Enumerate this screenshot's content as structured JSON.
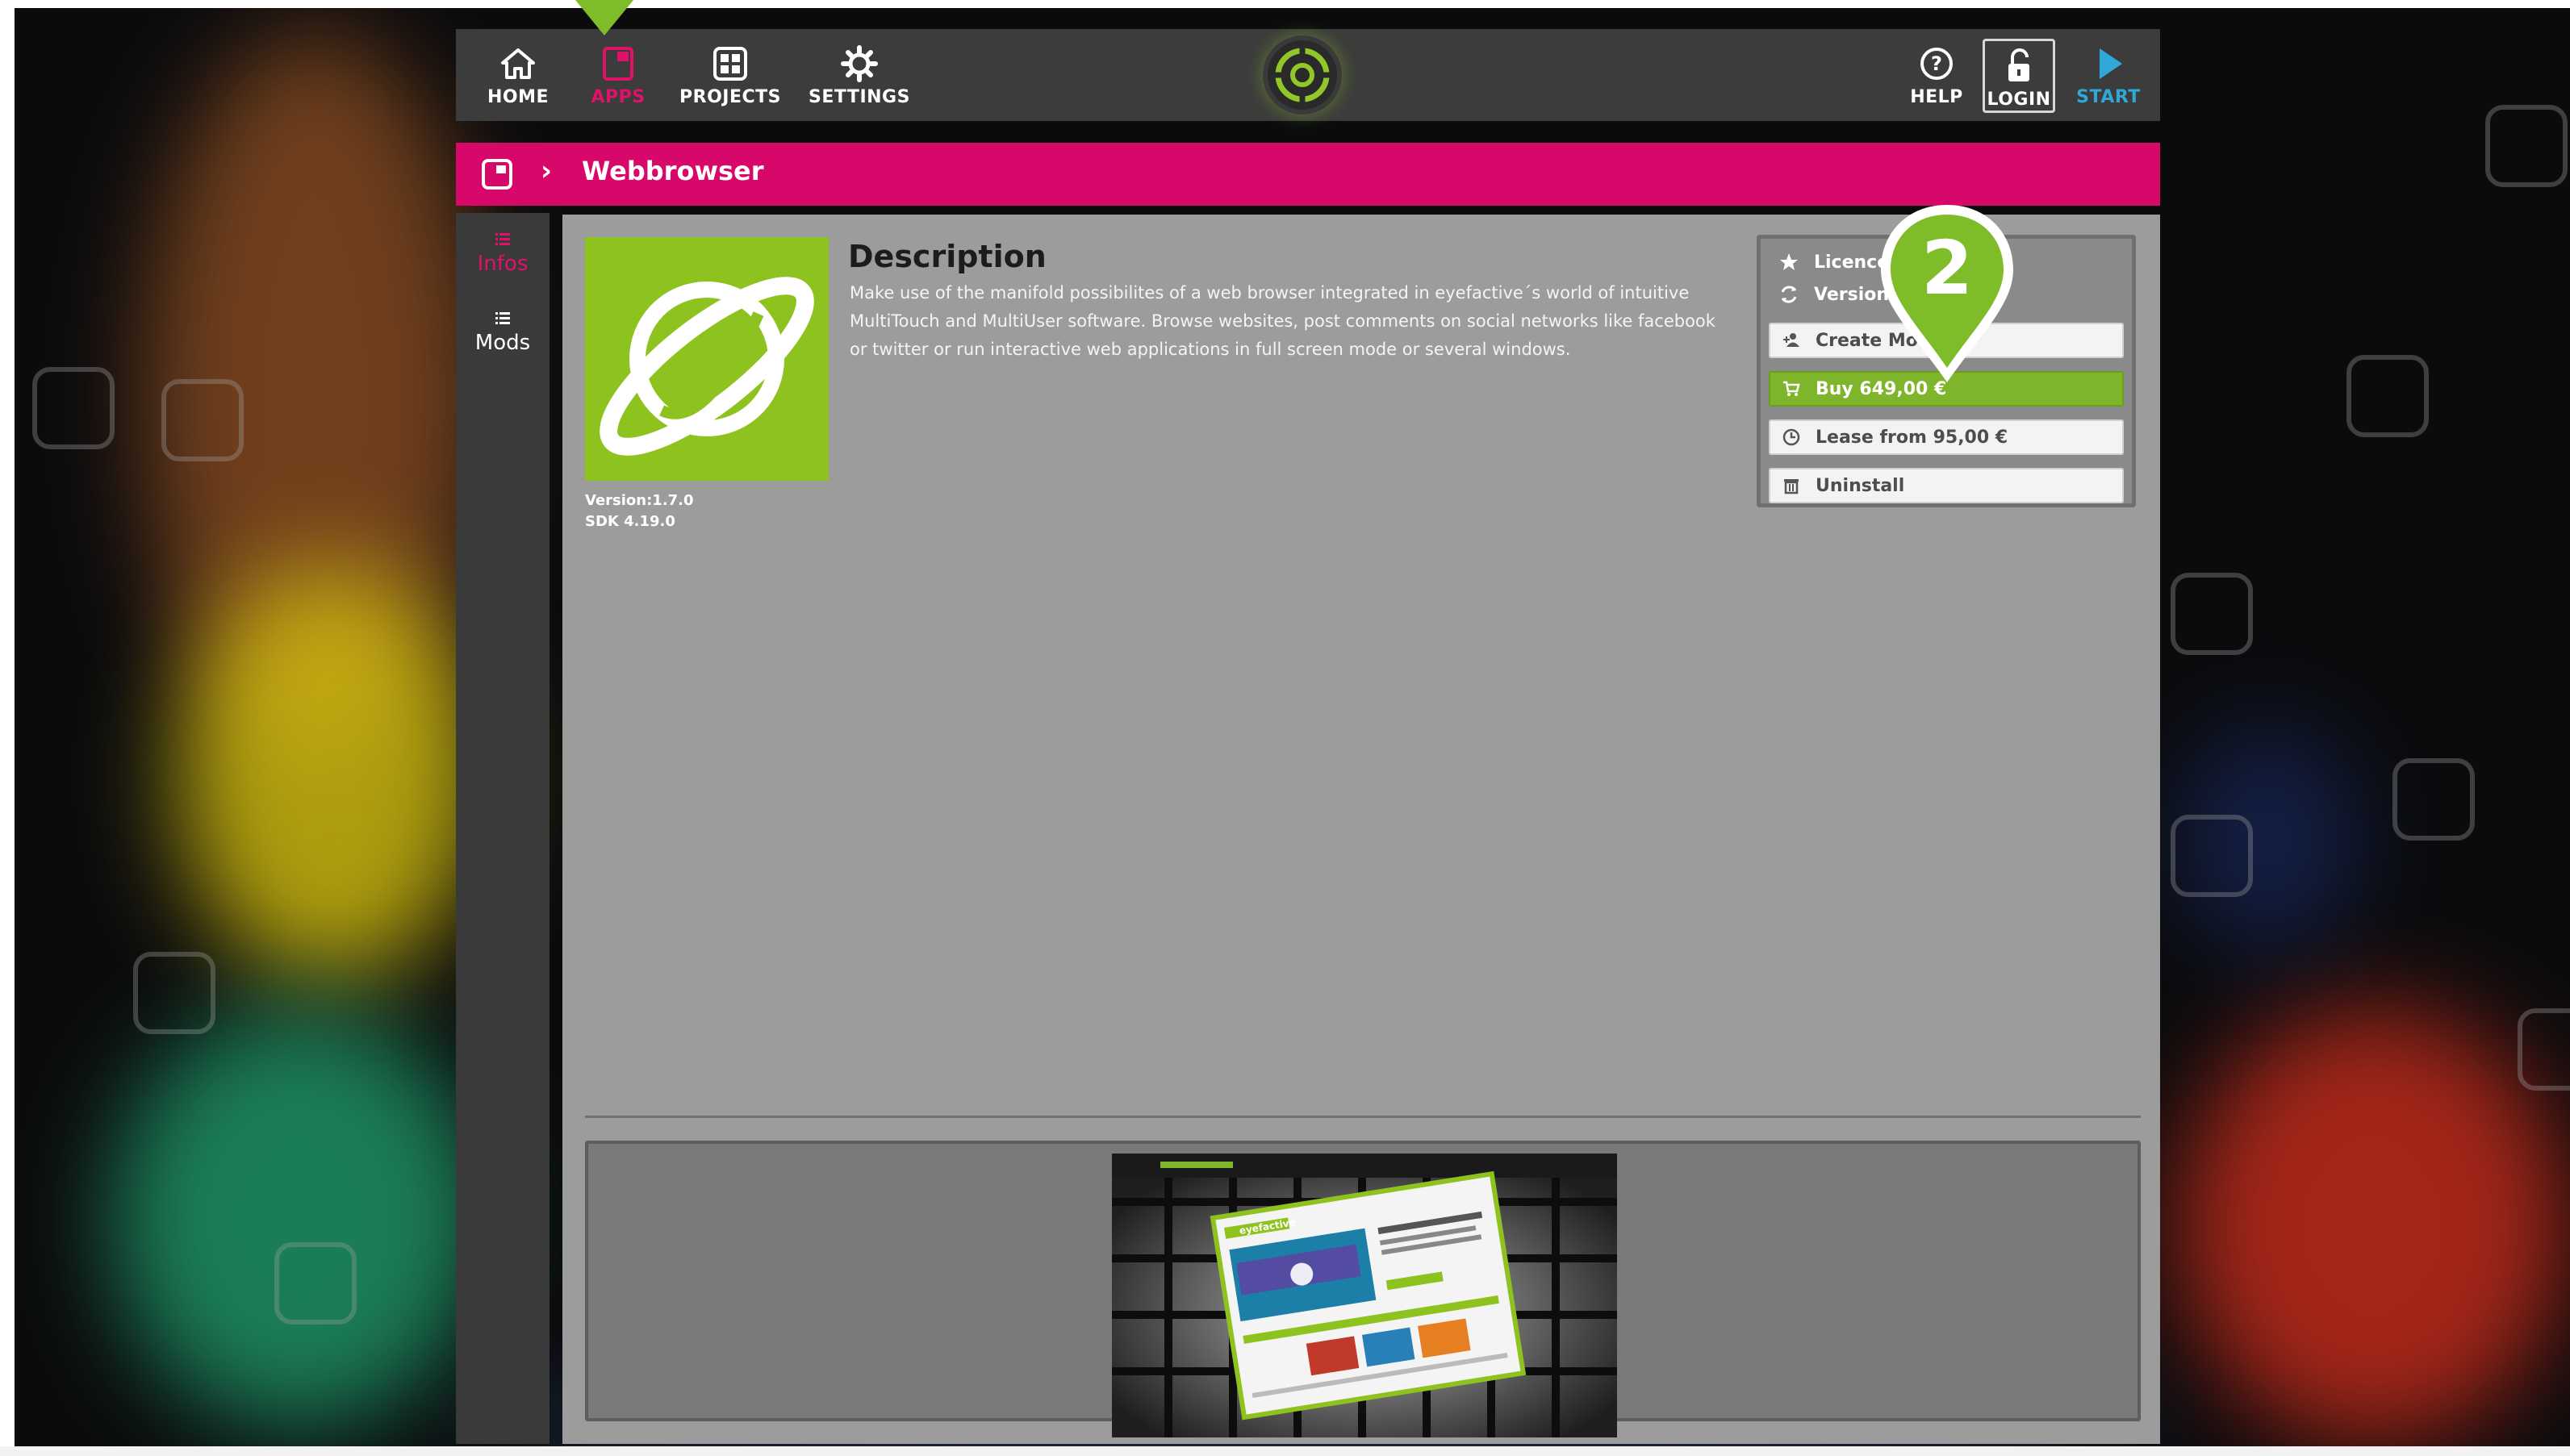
{
  "colors": {
    "accent_pink": "#d8076a",
    "accent_green": "#7eb52a",
    "start_blue": "#2fa8d8",
    "topbar": "#3c3c3c",
    "content_gray": "#9c9c9c"
  },
  "topnav": {
    "home": {
      "label": "HOME",
      "icon": "home-icon"
    },
    "apps": {
      "label": "APPS",
      "icon": "apps-icon",
      "active": true
    },
    "projects": {
      "label": "PROJECTS",
      "icon": "projects-icon"
    },
    "settings": {
      "label": "SETTINGS",
      "icon": "gear-icon"
    },
    "help": {
      "label": "HELP",
      "icon": "help-icon"
    },
    "login": {
      "label": "LOGIN",
      "icon": "unlock-icon"
    },
    "start": {
      "label": "START",
      "icon": "play-icon"
    }
  },
  "breadcrumb": {
    "separator": "›",
    "title": "Webbrowser"
  },
  "sidebar": {
    "infos": {
      "label": "Infos",
      "active": true
    },
    "mods": {
      "label": "Mods"
    }
  },
  "app": {
    "version": "Version:1.7.0",
    "sdk": "SDK 4.19.0"
  },
  "description": {
    "title": "Description",
    "text": "Make use of the manifold possibilites of a web browser integrated in eyefactive´s world of intuitive MultiTouch and MultiUser software. Browse websites, post comments on social networks like facebook or twitter or run interactive web applications in full screen mode or several windows."
  },
  "panel": {
    "licence_label": "Licence",
    "version_label": "Version",
    "create_label": "Create Mod",
    "buy_label": "Buy 649,00 €",
    "lease_label": "Lease from 95,00 €",
    "uninstall_label": "Uninstall"
  },
  "annotation": {
    "step_number": "2"
  },
  "gallery": {
    "screenshot_brand": "eyefactive"
  }
}
